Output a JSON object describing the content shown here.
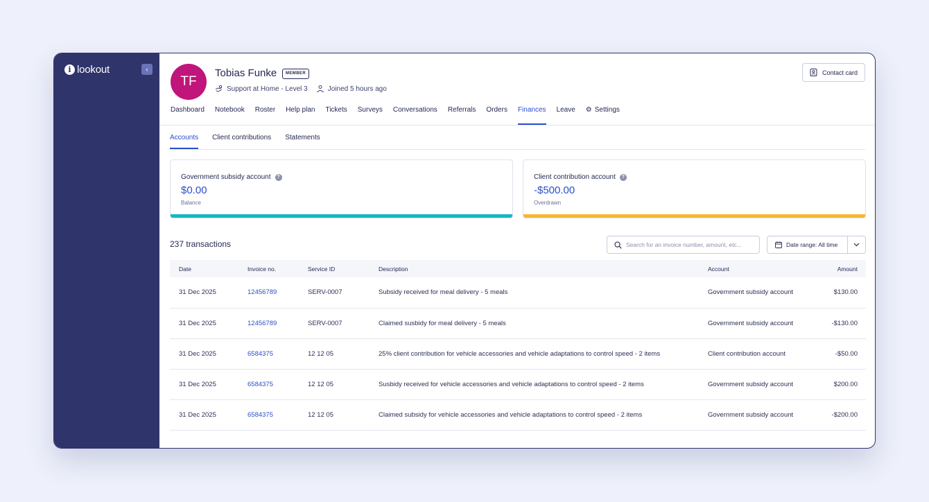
{
  "app": {
    "logo_text": "lookout",
    "collapse_icon": "chevron-left-icon"
  },
  "profile": {
    "initials": "TF",
    "name": "Tobias Funke",
    "badge": "MEMBER",
    "plan": "Support at Home - Level 3",
    "joined": "Joined 5 hours ago",
    "avatar_color": "#c0157a"
  },
  "header": {
    "contact_card_label": "Contact card"
  },
  "nav": {
    "items": [
      {
        "label": "Dashboard"
      },
      {
        "label": "Notebook"
      },
      {
        "label": "Roster"
      },
      {
        "label": "Help plan"
      },
      {
        "label": "Tickets"
      },
      {
        "label": "Surveys"
      },
      {
        "label": "Conversations"
      },
      {
        "label": "Referrals"
      },
      {
        "label": "Orders"
      },
      {
        "label": "Finances"
      },
      {
        "label": "Leave"
      },
      {
        "label": "Settings"
      }
    ],
    "active": "Finances"
  },
  "subtabs": {
    "items": [
      {
        "label": "Accounts"
      },
      {
        "label": "Client contributions"
      },
      {
        "label": "Statements"
      }
    ],
    "active": "Accounts"
  },
  "accounts": [
    {
      "title": "Government subsidy account",
      "amount": "$0.00",
      "status": "Balance",
      "bar_color": "#14b8c4"
    },
    {
      "title": "Client contribution account",
      "amount": "-$500.00",
      "status": "Overdrawn",
      "bar_color": "#f7b731"
    }
  ],
  "transactions": {
    "count_label": "237 transactions",
    "search_placeholder": "Search for an invoice number, amount, etc...",
    "date_range_label": "Date range: All time",
    "columns": [
      "Date",
      "Invoice no.",
      "Service ID",
      "Description",
      "Account",
      "Amount"
    ],
    "rows": [
      {
        "date": "31 Dec 2025",
        "invoice": "12456789",
        "service": "SERV-0007",
        "description": "Subsidy received for meal delivery - 5 meals",
        "account": "Government subsidy account",
        "amount": "$130.00"
      },
      {
        "date": "31 Dec 2025",
        "invoice": "12456789",
        "service": "SERV-0007",
        "description": "Claimed susbidy for meal delivery - 5 meals",
        "account": "Government subsidy account",
        "amount": "-$130.00"
      },
      {
        "date": "31 Dec 2025",
        "invoice": "6584375",
        "service": "12 12 05",
        "description": "25% client contribution for vehicle accessories and vehicle adaptations to control speed - 2 items",
        "account": "Client contribution account",
        "amount": "-$50.00"
      },
      {
        "date": "31 Dec 2025",
        "invoice": "6584375",
        "service": "12 12 05",
        "description": "Susbidy received for vehicle accessories and vehicle adaptations to control speed - 2 items",
        "account": "Government subsidy account",
        "amount": "$200.00"
      },
      {
        "date": "31 Dec 2025",
        "invoice": "6584375",
        "service": "12 12 05",
        "description": "Claimed subsidy for vehicle accessories and vehicle adaptations to control speed - 2 items",
        "account": "Government subsidy account",
        "amount": "-$200.00"
      }
    ]
  },
  "colors": {
    "sidebar": "#2f346b",
    "accent": "#2a4ec9"
  }
}
